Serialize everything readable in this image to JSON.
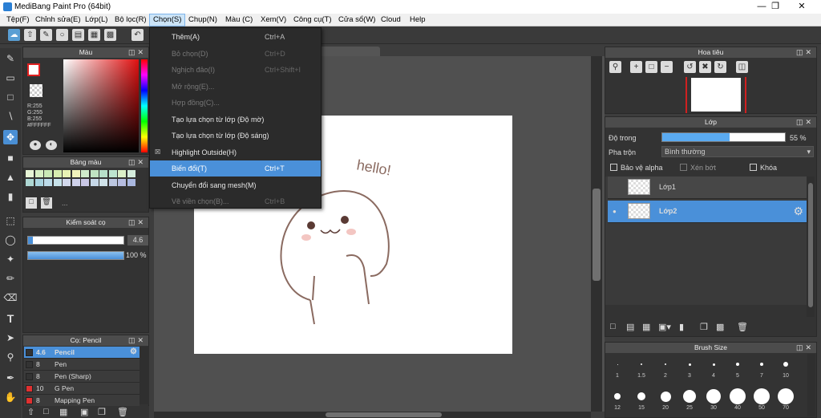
{
  "window": {
    "title": "MediBang Paint Pro (64bit)"
  },
  "menubar": [
    "Tệp(F)",
    "Chỉnh sửa(E)",
    "Lớp(L)",
    "Bộ lọc(R)",
    "Chọn(S)",
    "Chụp(N)",
    "Màu (C)",
    "Xem(V)",
    "Công cụ(T)",
    "Cửa sổ(W)",
    "Cloud",
    "Help"
  ],
  "active_menu": "Chọn(S)",
  "dropdown": [
    {
      "label": "Thêm(A)",
      "shortcut": "Ctrl+A",
      "state": "enabled"
    },
    {
      "label": "Bỏ chọn(D)",
      "shortcut": "Ctrl+D",
      "state": "disabled"
    },
    {
      "label": "Nghịch đảo(I)",
      "shortcut": "Ctrl+Shift+I",
      "state": "disabled"
    },
    {
      "label": "Mở rộng(E)...",
      "shortcut": "",
      "state": "disabled"
    },
    {
      "label": "Hợp đồng(C)...",
      "shortcut": "",
      "state": "disabled"
    },
    {
      "label": "Tạo lựa chọn từ lớp (Độ mờ)",
      "shortcut": "",
      "state": "enabled"
    },
    {
      "label": "Tạo lựa chọn từ lớp (Độ sáng)",
      "shortcut": "",
      "state": "enabled"
    },
    {
      "label": "Highlight Outside(H)",
      "shortcut": "",
      "state": "checked"
    },
    {
      "label": "Biến đổi(T)",
      "shortcut": "Ctrl+T",
      "state": "highlighted"
    },
    {
      "label": "Chuyển đổi sang mesh(M)",
      "shortcut": "",
      "state": "enabled"
    },
    {
      "label": "Vẽ viền chọn(B)...",
      "shortcut": "Ctrl+B",
      "state": "disabled"
    }
  ],
  "color_panel": {
    "title": "Màu",
    "r": "R:255",
    "g": "G:255",
    "b": "B:255",
    "hex": "#FFFFFF",
    "primary_color": "#ffffff"
  },
  "palette_panel": {
    "title": "Bảng màu",
    "more": "..."
  },
  "brush_control": {
    "title": "Kiểm soát cọ",
    "size": "4.6",
    "opacity": "100 %",
    "opacity_level": 1.0
  },
  "brush_panel": {
    "title": "Cọ: Pencil",
    "items": [
      {
        "size": "4.6",
        "name": "Pencil",
        "color": "#333333",
        "selected": true
      },
      {
        "size": "8",
        "name": "Pen",
        "color": "#333333"
      },
      {
        "size": "8",
        "name": "Pen (Sharp)",
        "color": "#333333"
      },
      {
        "size": "10",
        "name": "G Pen",
        "color": "#e03030"
      },
      {
        "size": "8",
        "name": "Mapping Pen",
        "color": "#e03030"
      }
    ]
  },
  "navigator": {
    "title": "Hoa tiêu"
  },
  "layer_panel": {
    "title": "Lớp",
    "opacity_label": "Độ trong",
    "opacity_value": "55 %",
    "opacity_level": 0.55,
    "blend_label": "Pha trộn",
    "blend_value": "Bình thường",
    "protect_alpha": "Bảo vệ alpha",
    "clipping": "Xén bớt",
    "lock": "Khóa",
    "layers": [
      {
        "name": "Lớp1",
        "selected": false
      },
      {
        "name": "Lớp2",
        "selected": true
      }
    ]
  },
  "brush_size_panel": {
    "title": "Brush Size",
    "row1": [
      "1",
      "1.5",
      "2",
      "3",
      "4",
      "5",
      "7",
      "10"
    ],
    "row2": [
      "12",
      "15",
      "20",
      "25",
      "30",
      "40",
      "50",
      "70"
    ]
  },
  "artwork": {
    "text": "hello!"
  }
}
